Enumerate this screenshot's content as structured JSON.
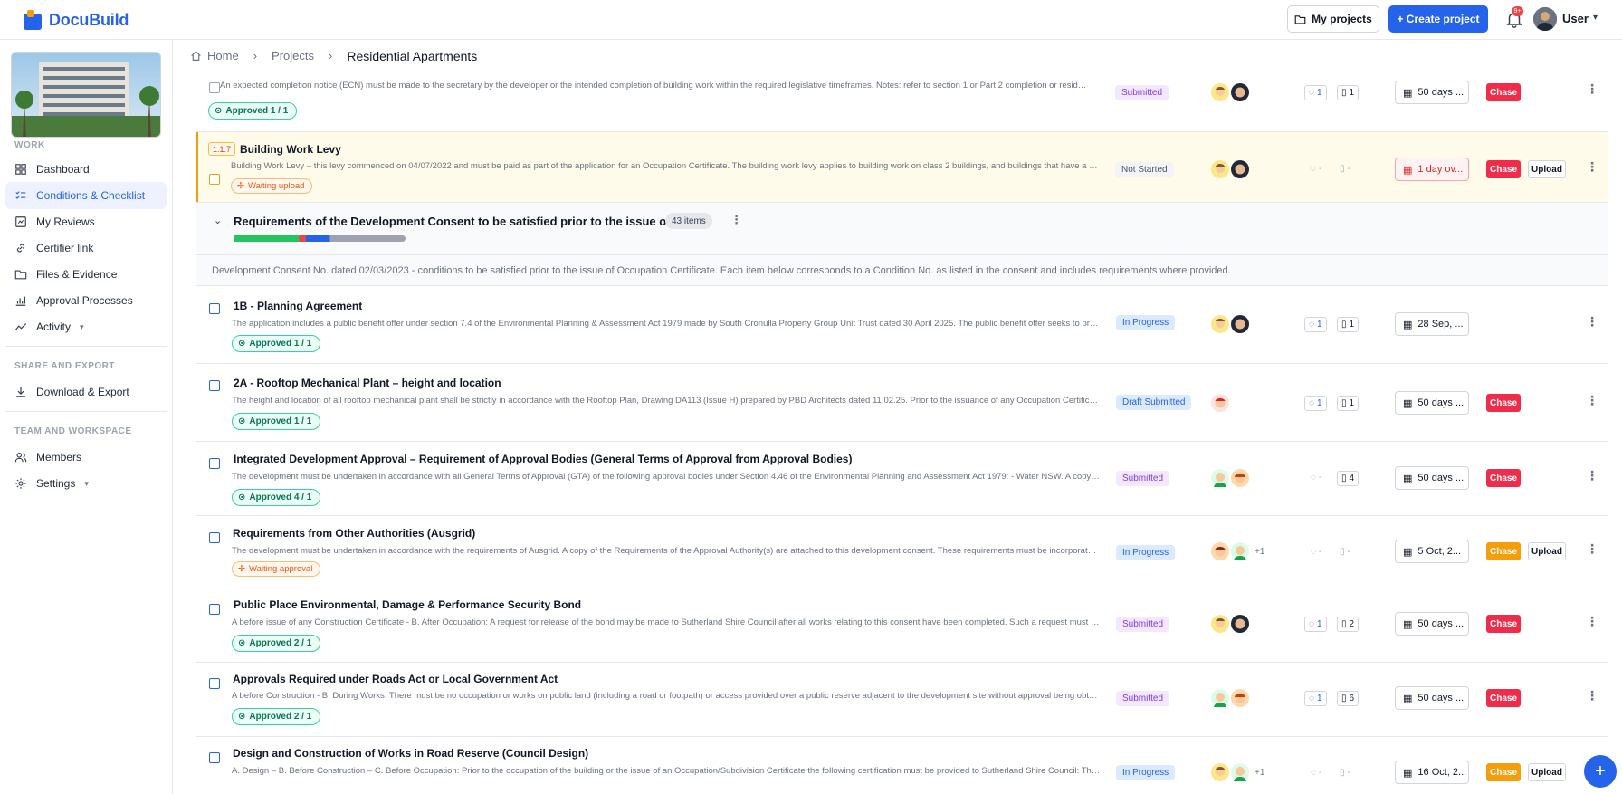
{
  "app": {
    "name": "DocuBuild"
  },
  "header": {
    "my_projects": "My projects",
    "create_project": "+ Create project",
    "notif_count": "9+",
    "user": "User"
  },
  "sidebar": {
    "work_label": "WORK",
    "work_items": [
      "Dashboard",
      "Conditions & Checklist",
      "My Reviews",
      "Certifier link",
      "Files & Evidence",
      "Approval Processes",
      "Activity"
    ],
    "share_label": "SHARE AND EXPORT",
    "share_items": [
      "Download & Export"
    ],
    "team_label": "TEAM AND WORKSPACE",
    "team_items": [
      "Members",
      "Settings"
    ]
  },
  "breadcrumb": {
    "home": "Home",
    "projects": "Projects",
    "current": "Residential Apartments"
  },
  "group": {
    "title": "Requirements of the Development Consent to be satisfied prior to the issue of OC",
    "count": "43 items",
    "note": "Development Consent No. dated 02/03/2023 - conditions to be satisfied prior to the issue of Occupation Certificate. Each item below corresponds to a Condition No. as listed in the consent and includes requirements where provided.",
    "progress": {
      "green": 0.38,
      "red": 0.04,
      "blue": 0.14
    }
  },
  "rows": [
    {
      "title": "",
      "desc": "An expected completion notice (ECN) must be made to the secretary by the developer or the intended completion of building work within the required legislative timeframes. Notes: refer to section 1 or Part 2 completion or residential...",
      "badge": "Approved 1 / 1",
      "badge_type": "ok",
      "status": "Submitted",
      "status_type": "sub",
      "comments": "1",
      "files": "1",
      "date": "50 days ...",
      "chase": "Chase",
      "chase_color": "red",
      "upload": ""
    },
    {
      "tag": "1.1.7",
      "title": "Building Work Levy",
      "desc": "Building Work Levy – this levy commenced on 04/07/2022 and must be paid as part of the application for an Occupation Certificate. The building work levy applies to building work on class 2 buildings, and buildings that have a class 2 par...",
      "badge": "Waiting upload",
      "badge_type": "wait",
      "status": "Not Started",
      "status_type": "not",
      "comments": "-",
      "files": "-",
      "date": "1 day ov...",
      "chase": "Chase",
      "chase_color": "red",
      "upload": "Upload"
    },
    {
      "title": "1B - Planning Agreement",
      "desc": "The application includes a public benefit offer under section 7.4 of the Environmental Planning & Assessment Act 1979 made by South Cronulla Property Group Unit Trust dated 30 April 2025. The public benefit offer seeks to provide material...",
      "badge": "Approved 1 / 1",
      "badge_type": "ok",
      "status": "In Progress",
      "status_type": "prog",
      "comments": "1",
      "files": "1",
      "date": "28 Sep, ...",
      "chase": "",
      "chase_color": "",
      "upload": ""
    },
    {
      "title": "2A - Rooftop Mechanical Plant – height and location",
      "desc": "The height and location of all rooftop mechanical plant shall be strictly in accordance with the Rooftop Plan, Drawing DA113 (Issue H) prepared by PBD Architects dated 11.02.25. Prior to the issuance of any Occupation Certification, certificati...",
      "badge": "Approved 1 / 1",
      "badge_type": "ok",
      "status": "Draft Submitted",
      "status_type": "draft",
      "comments": "1",
      "files": "1",
      "date": "50 days ...",
      "chase": "Chase",
      "chase_color": "red",
      "upload": ""
    },
    {
      "title": "Integrated Development Approval – Requirement of Approval Bodies (General Terms of Approval from Approval Bodies)",
      "desc": "The development must be undertaken in accordance with all General Terms of Approval (GTA) of the following approval bodies under Section 4.46 of the Environmental Planning and Assessment Act 1979: - Water NSW. A copy of each of the...",
      "badge": "Approved 4 / 1",
      "badge_type": "ok",
      "status": "Submitted",
      "status_type": "sub",
      "comments": "-",
      "files": "4",
      "date": "50 days ...",
      "chase": "Chase",
      "chase_color": "red",
      "upload": ""
    },
    {
      "title": "Requirements from Other Authorities (Ausgrid)",
      "desc": "The development must be undertaken in accordance with the requirements of Ausgrid. A copy of the Requirements of the Approval Authority(s) are attached to this development consent. These requirements must be incorporated in the...",
      "badge": "Waiting approval",
      "badge_type": "wait",
      "status": "In Progress",
      "status_type": "prog",
      "comments": "-",
      "files": "-",
      "date": "5 Oct, 2...",
      "chase": "Chase",
      "chase_color": "orange",
      "upload": "Upload",
      "extra": "+1"
    },
    {
      "title": "Public Place Environmental, Damage & Performance Security Bond",
      "desc": "A before issue of any Construction Certificate - B. After Occupation: A request for release of the bond may be made to Sutherland Shire Council after all works relating to this consent have been completed. Such a request must be...",
      "badge": "Approved 2 / 1",
      "badge_type": "ok",
      "status": "Submitted",
      "status_type": "sub",
      "comments": "1",
      "files": "2",
      "date": "50 days ...",
      "chase": "Chase",
      "chase_color": "red",
      "upload": ""
    },
    {
      "title": "Approvals Required under Roads Act or Local Government Act",
      "desc": "A before Construction - B. During Works: There must be no occupation or works on public land (including a road or footpath) or access provided over a public reserve adjacent to the development site without approval being obtained from...",
      "badge": "Approved 2 / 1",
      "badge_type": "ok",
      "status": "Submitted",
      "status_type": "sub",
      "comments": "1",
      "files": "6",
      "date": "50 days ...",
      "chase": "Chase",
      "chase_color": "red",
      "upload": ""
    },
    {
      "title": "Design and Construction of Works in Road Reserve (Council Design)",
      "desc": "A. Design – B. Before Construction – C. Before Occupation: Prior to the occupation of the building or the issue of an Occupation/Subdivision Certificate the following certification must be provided to Sutherland Shire Council: The supervisin...",
      "badge": "",
      "badge_type": "",
      "status": "In Progress",
      "status_type": "prog",
      "comments": "-",
      "files": "-",
      "date": "16 Oct, 2...",
      "chase": "Chase",
      "chase_color": "orange",
      "upload": "Upload",
      "extra": "+1"
    }
  ],
  "colors": {
    "primary": "#2563eb",
    "chase_red": "#ef2d4a",
    "chase_orange": "#f59e0b",
    "approved_green": "#047857"
  }
}
